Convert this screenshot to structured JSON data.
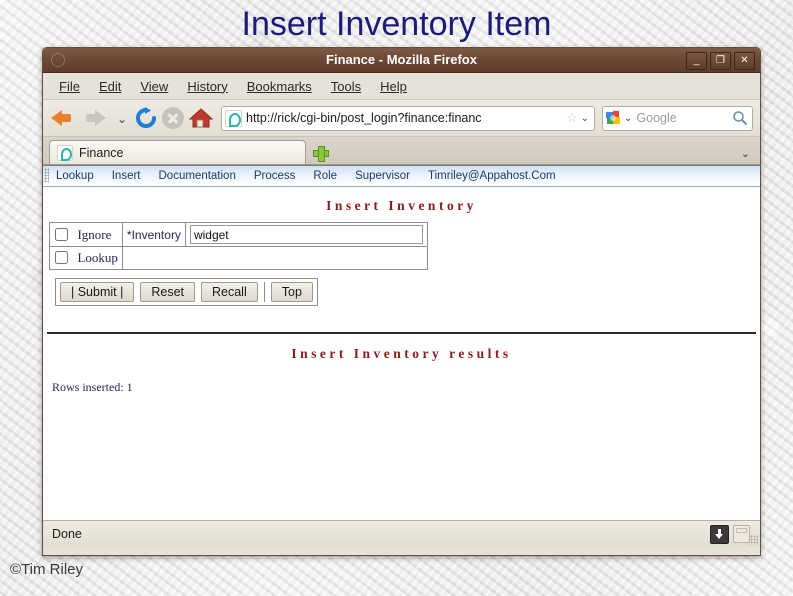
{
  "slide": {
    "title": "Insert Inventory Item",
    "title_color": "#1b1b78",
    "copyright": "©Tim Riley"
  },
  "browser": {
    "window_title": "Finance - Mozilla Firefox",
    "window_controls": {
      "minimize": "_",
      "maximize": "❐",
      "close": "✕"
    },
    "menu": [
      {
        "label": "File"
      },
      {
        "label": "Edit"
      },
      {
        "label": "View"
      },
      {
        "label": "History"
      },
      {
        "label": "Bookmarks"
      },
      {
        "label": "Tools"
      },
      {
        "label": "Help"
      }
    ],
    "toolbar": {
      "back_icon": "back-arrow-icon",
      "forward_icon": "forward-arrow-icon",
      "history_dropdown_icon": "chevron-down-icon",
      "reload_icon": "reload-icon",
      "stop_icon": "stop-icon",
      "home_icon": "home-icon",
      "url": "http://rick/cgi-bin/post_login?finance:financ",
      "url_star_icon": "star-icon",
      "url_dropdown_icon": "chevron-down-icon",
      "search_engine_icon": "google-icon",
      "search_placeholder": "Google",
      "search_go_icon": "magnifier-icon"
    },
    "tabs": {
      "items": [
        {
          "label": "Finance",
          "favicon": "finance-favicon"
        }
      ],
      "new_tab_label": "+",
      "tab_list_icon": "chevron-down-icon"
    },
    "statusbar": {
      "text": "Done",
      "download_icon": "download-icon",
      "misc_icon": "page-icon"
    }
  },
  "app": {
    "nav": [
      {
        "label": "Lookup"
      },
      {
        "label": "Insert"
      },
      {
        "label": "Documentation"
      },
      {
        "label": "Process"
      },
      {
        "label": "Role"
      },
      {
        "label": "Supervisor"
      },
      {
        "label": "Timriley@Appahost.Com"
      }
    ],
    "form": {
      "heading": "Insert Inventory",
      "heading_color": "#8b1a1a",
      "checkboxes": [
        {
          "label": "Ignore",
          "checked": false
        },
        {
          "label": "Lookup",
          "checked": false
        }
      ],
      "field_label": "*Inventory",
      "field_value": "widget",
      "buttons": [
        {
          "label": "|  Submit  |"
        },
        {
          "label": "Reset"
        },
        {
          "label": "Recall"
        },
        {
          "label": "Top"
        }
      ]
    },
    "results": {
      "heading": "Insert Inventory results",
      "heading_color": "#8b1a1a",
      "message": "Rows inserted: 1"
    }
  }
}
